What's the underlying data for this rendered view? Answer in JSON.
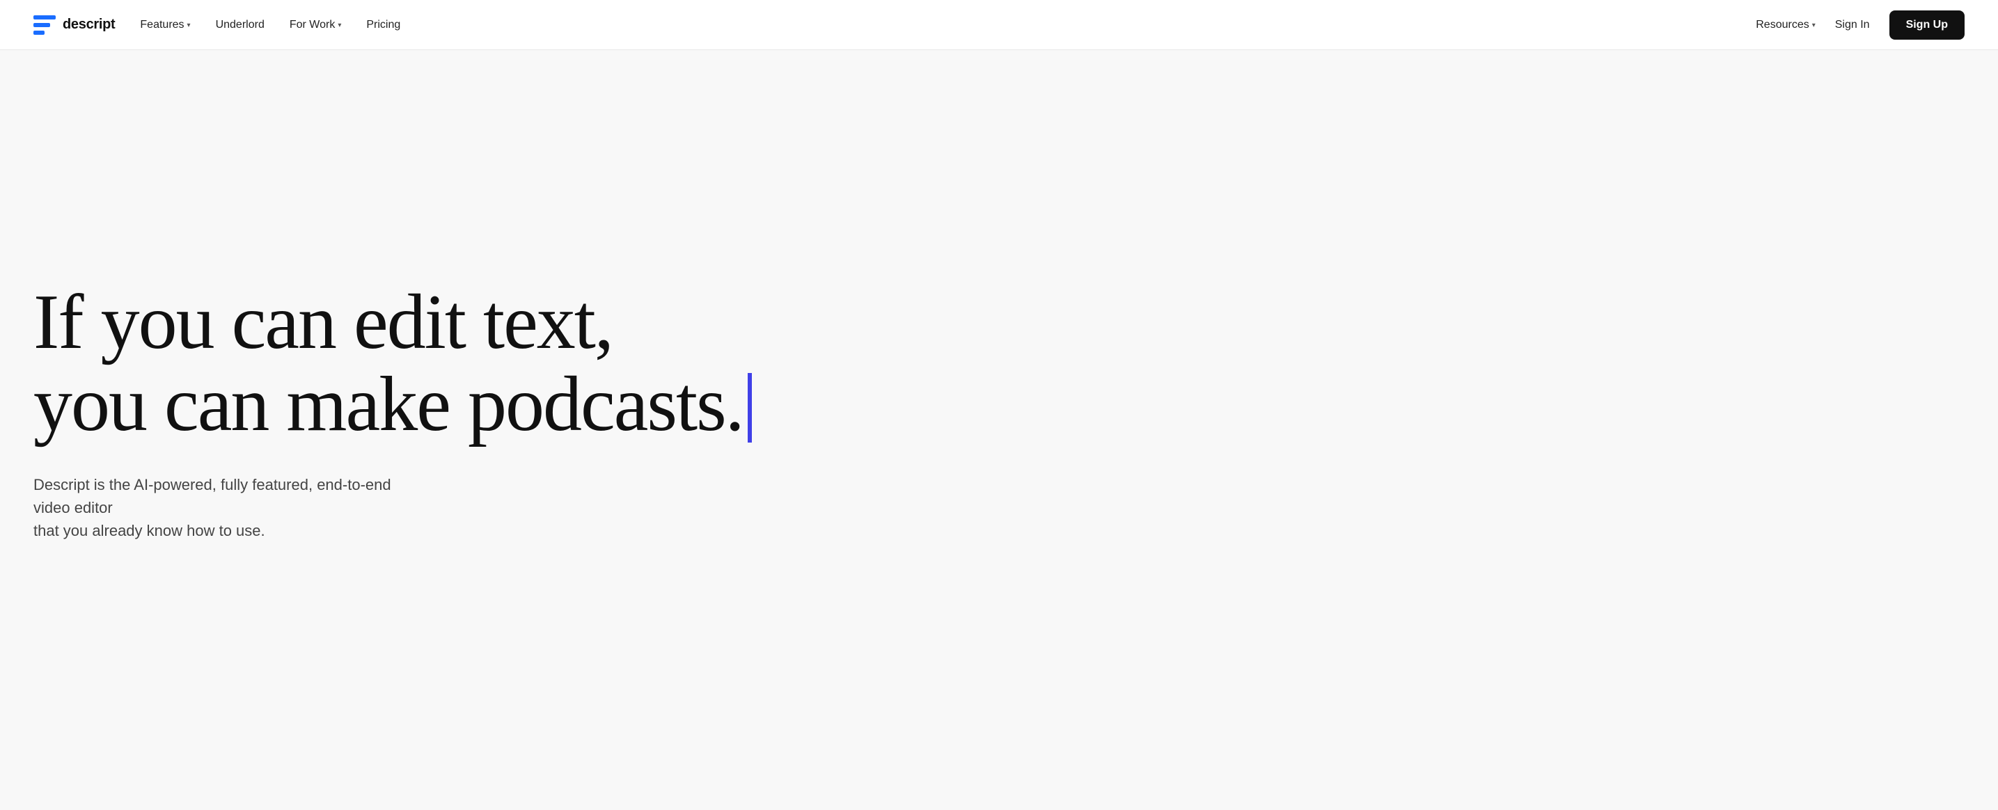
{
  "nav": {
    "logo_text": "descript",
    "links": [
      {
        "label": "Features",
        "has_dropdown": true
      },
      {
        "label": "Underlord",
        "has_dropdown": false
      },
      {
        "label": "For Work",
        "has_dropdown": true
      },
      {
        "label": "Pricing",
        "has_dropdown": false
      }
    ],
    "right_links": [
      {
        "label": "Resources",
        "has_dropdown": true
      }
    ],
    "sign_in_label": "Sign In",
    "sign_up_label": "Sign Up"
  },
  "hero": {
    "headline_line1": "If you can edit text,",
    "headline_line2": "you can make podcasts.",
    "subtext_line1": "Descript is the AI-powered, fully featured, end-to-end video editor",
    "subtext_line2": "that you already know how to use."
  },
  "icons": {
    "chevron_down": "▾"
  }
}
